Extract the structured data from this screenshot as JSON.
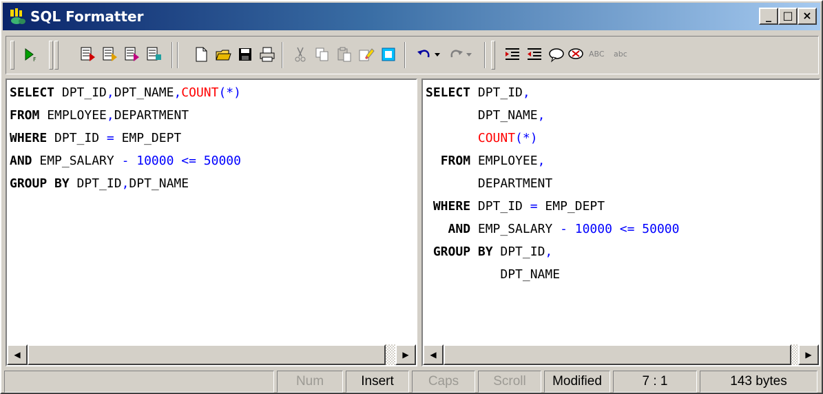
{
  "window": {
    "title": "SQL Formatter"
  },
  "window_controls": {
    "minimize": "_",
    "maximize": "□",
    "close": "×"
  },
  "toolbar": {
    "format_icon": "run-format-icon",
    "text_abc_upper": "ABC",
    "text_abc_lower": "abc"
  },
  "left_pane": {
    "lines": [
      [
        {
          "t": "SELECT",
          "s": "kw"
        },
        {
          "t": " DPT_ID"
        },
        {
          "t": ",",
          "s": "blue"
        },
        {
          "t": "DPT_NAME"
        },
        {
          "t": ",",
          "s": "blue"
        },
        {
          "t": "COUNT",
          "s": "red"
        },
        {
          "t": "(*)",
          "s": "blue"
        }
      ],
      [
        {
          "t": "FROM",
          "s": "kw"
        },
        {
          "t": " EMPLOYEE"
        },
        {
          "t": ",",
          "s": "blue"
        },
        {
          "t": "DEPARTMENT"
        }
      ],
      [
        {
          "t": "WHERE",
          "s": "kw"
        },
        {
          "t": " DPT_ID "
        },
        {
          "t": "=",
          "s": "blue"
        },
        {
          "t": " EMP_DEPT"
        }
      ],
      [
        {
          "t": "AND",
          "s": "kw"
        },
        {
          "t": " EMP_SALARY "
        },
        {
          "t": "- 10000 <= 50000",
          "s": "blue"
        }
      ],
      [
        {
          "t": "GROUP BY",
          "s": "kw"
        },
        {
          "t": " DPT_ID"
        },
        {
          "t": ",",
          "s": "blue"
        },
        {
          "t": "DPT_NAME"
        }
      ]
    ]
  },
  "right_pane": {
    "lines": [
      [
        {
          "t": "SELECT",
          "s": "kw"
        },
        {
          "t": " DPT_ID"
        },
        {
          "t": ",",
          "s": "blue"
        }
      ],
      [
        {
          "t": "       DPT_NAME"
        },
        {
          "t": ",",
          "s": "blue"
        }
      ],
      [
        {
          "t": "       "
        },
        {
          "t": "COUNT",
          "s": "red"
        },
        {
          "t": "(*)",
          "s": "blue"
        }
      ],
      [
        {
          "t": "  "
        },
        {
          "t": "FROM",
          "s": "kw"
        },
        {
          "t": " EMPLOYEE"
        },
        {
          "t": ",",
          "s": "blue"
        }
      ],
      [
        {
          "t": "       DEPARTMENT"
        }
      ],
      [
        {
          "t": " "
        },
        {
          "t": "WHERE",
          "s": "kw"
        },
        {
          "t": " DPT_ID "
        },
        {
          "t": "=",
          "s": "blue"
        },
        {
          "t": " EMP_DEPT"
        }
      ],
      [
        {
          "t": "   "
        },
        {
          "t": "AND",
          "s": "kw"
        },
        {
          "t": " EMP_SALARY "
        },
        {
          "t": "- 10000 <= 50000",
          "s": "blue"
        }
      ],
      [
        {
          "t": " "
        },
        {
          "t": "GROUP BY",
          "s": "kw"
        },
        {
          "t": " DPT_ID"
        },
        {
          "t": ",",
          "s": "blue"
        }
      ],
      [
        {
          "t": "          DPT_NAME"
        }
      ]
    ]
  },
  "scrollbar": {
    "left_arrow": "◀",
    "right_arrow": "▶"
  },
  "statusbar": {
    "num": "Num",
    "insert": "Insert",
    "caps": "Caps",
    "scroll": "Scroll",
    "modified": "Modified",
    "position": "7 : 1",
    "size": "143 bytes"
  },
  "colors": {
    "keyword_red": "#ff0000",
    "operator_blue": "#0000ff",
    "title_gradient_start": "#0a246a"
  }
}
